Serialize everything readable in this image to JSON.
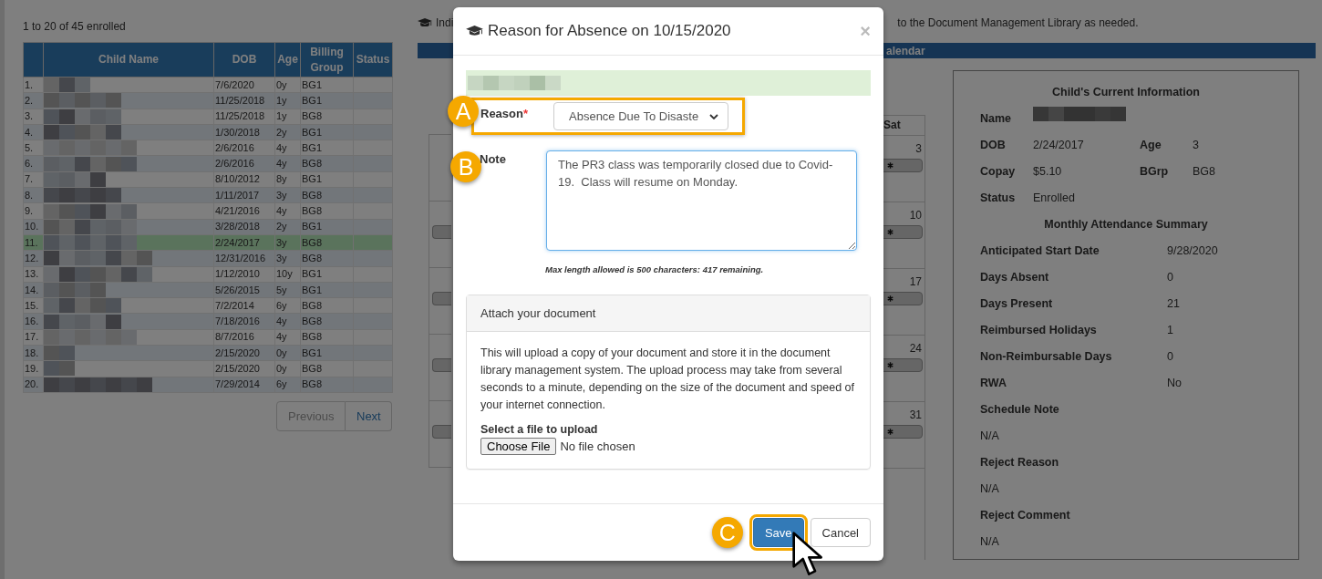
{
  "roster": {
    "summary": "1 to 20 of 45 enrolled",
    "columns": [
      "Child Name",
      "DOB",
      "Age",
      "Billing Group",
      "Status"
    ],
    "rows": [
      {
        "number": "1.",
        "dob": "7/6/2020",
        "age": "0y",
        "group": "BG1",
        "selected": false
      },
      {
        "number": "2.",
        "dob": "11/25/2018",
        "age": "1y",
        "group": "BG1",
        "selected": false
      },
      {
        "number": "3.",
        "dob": "11/25/2018",
        "age": "1y",
        "group": "BG8",
        "selected": false
      },
      {
        "number": "4.",
        "dob": "1/30/2018",
        "age": "2y",
        "group": "BG1",
        "selected": false
      },
      {
        "number": "5.",
        "dob": "2/6/2016",
        "age": "4y",
        "group": "BG1",
        "selected": false
      },
      {
        "number": "6.",
        "dob": "2/6/2016",
        "age": "4y",
        "group": "BG8",
        "selected": false
      },
      {
        "number": "7.",
        "dob": "8/10/2012",
        "age": "8y",
        "group": "BG1",
        "selected": false
      },
      {
        "number": "8.",
        "dob": "1/11/2017",
        "age": "3y",
        "group": "BG8",
        "selected": false
      },
      {
        "number": "9.",
        "dob": "4/21/2016",
        "age": "4y",
        "group": "BG8",
        "selected": false
      },
      {
        "number": "10.",
        "dob": "3/28/2018",
        "age": "2y",
        "group": "BG1",
        "selected": false
      },
      {
        "number": "11.",
        "dob": "2/24/2017",
        "age": "3y",
        "group": "BG8",
        "selected": true
      },
      {
        "number": "12.",
        "dob": "12/31/2016",
        "age": "3y",
        "group": "BG8",
        "selected": false
      },
      {
        "number": "13.",
        "dob": "1/12/2010",
        "age": "10y",
        "group": "BG1",
        "selected": false
      },
      {
        "number": "14.",
        "dob": "5/26/2015",
        "age": "5y",
        "group": "BG1",
        "selected": false
      },
      {
        "number": "15.",
        "dob": "7/2/2014",
        "age": "6y",
        "group": "BG8",
        "selected": false
      },
      {
        "number": "16.",
        "dob": "7/18/2016",
        "age": "4y",
        "group": "BG8",
        "selected": false
      },
      {
        "number": "17.",
        "dob": "8/7/2016",
        "age": "4y",
        "group": "BG8",
        "selected": false
      },
      {
        "number": "18.",
        "dob": "2/15/2020",
        "age": "0y",
        "group": "BG1",
        "selected": false
      },
      {
        "number": "19.",
        "dob": "2/15/2020",
        "age": "0y",
        "group": "BG8",
        "selected": false
      },
      {
        "number": "20.",
        "dob": "7/29/2014",
        "age": "6y",
        "group": "BG8",
        "selected": false
      }
    ],
    "pager": [
      "Previous",
      "Next"
    ]
  },
  "instructions": {
    "start": "Indi",
    "end": "to the Document Management Library as needed."
  },
  "calendar": {
    "title_fragment": "alendar",
    "day_header": "Sat",
    "weeks": [
      {
        "date": "3",
        "left_entry": false
      },
      {
        "date": "10",
        "left_entry": true
      },
      {
        "date": "17",
        "left_entry": true
      },
      {
        "date": "24",
        "left_entry": true
      },
      {
        "date": "31",
        "left_entry": true
      }
    ]
  },
  "child_info": {
    "title": "Child's Current Information",
    "name_label": "Name",
    "pairs": [
      {
        "label": "DOB",
        "value": "2/24/2017",
        "label2": "Age",
        "value2": "3"
      },
      {
        "label": "Copay",
        "value": "$5.10",
        "label2": "BGrp",
        "value2": "BG8"
      }
    ],
    "status": {
      "label": "Status",
      "value": "Enrolled"
    },
    "summary_title": "Monthly Attendance Summary",
    "summary": [
      {
        "label": "Anticipated Start Date",
        "value": "9/28/2020"
      },
      {
        "label": "Days Absent",
        "value": "0"
      },
      {
        "label": "Days Present",
        "value": "21"
      },
      {
        "label": "Reimbursed Holidays",
        "value": "1"
      },
      {
        "label": "Non-Reimbursable Days",
        "value": "0"
      },
      {
        "label": "RWA",
        "value": "No"
      }
    ],
    "notes": [
      {
        "label": "Schedule Note",
        "value": "N/A"
      },
      {
        "label": "Reject Reason",
        "value": "N/A"
      },
      {
        "label": "Reject Comment",
        "value": "N/A"
      }
    ]
  },
  "modal": {
    "title": "Reason for Absence on 10/15/2020",
    "close": "×",
    "reason": {
      "label": "Reason",
      "required_mark": "*",
      "value": "Absence Due To Disaste",
      "marker": "A"
    },
    "note": {
      "label": "Note",
      "value": "The PR3 class was temporarily closed due to Covid-19.  Class will resume on Monday.",
      "marker": "B"
    },
    "limit_text": "Max length allowed is 500 characters: 417 remaining.",
    "attachment": {
      "title": "Attach your document",
      "description": "This will upload a copy of your document and store it in the document library management system. The upload process may take from several seconds to a minute, depending on the size of the document and speed of your internet connection.",
      "file_label": "Select a file to upload",
      "button": "Choose File",
      "status": "No file chosen"
    },
    "buttons": [
      {
        "label": "Save",
        "kind": "primary",
        "highlighted": true,
        "marker": "C"
      },
      {
        "label": "Cancel",
        "kind": "default",
        "highlighted": false
      }
    ]
  }
}
